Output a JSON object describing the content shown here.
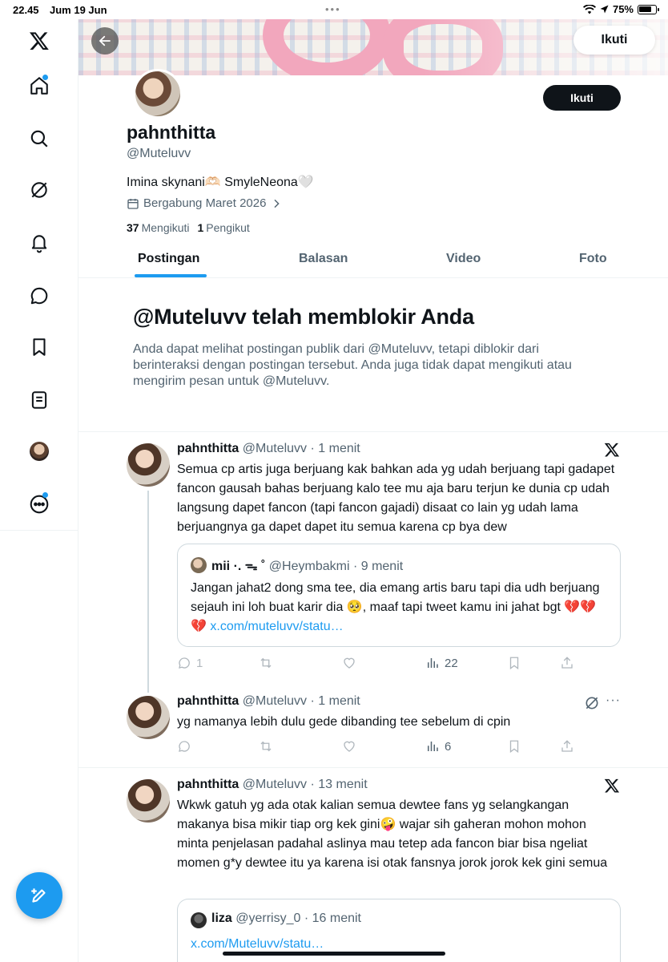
{
  "status_bar": {
    "time": "22.45",
    "date": "Jum 19 Jun",
    "battery": "75%"
  },
  "nav": {
    "items": [
      "x-logo",
      "home",
      "search",
      "grok",
      "notifications",
      "messages",
      "bookmarks",
      "lists",
      "profile",
      "more"
    ]
  },
  "header": {
    "top_follow_label": "Ikuti"
  },
  "profile": {
    "follow_label": "Ikuti",
    "name": "pahnthitta",
    "handle": "@Muteluvv",
    "bio": "Imina skynani🫶🏻 SmyleNeona🤍",
    "joined": "Bergabung Maret 2026",
    "following_count": "37",
    "following_label": "Mengikuti",
    "followers_count": "1",
    "followers_label": "Pengikut"
  },
  "tabs": [
    "Postingan",
    "Balasan",
    "Video",
    "Foto"
  ],
  "blocked": {
    "title": "@Muteluvv telah memblokir Anda",
    "description": "Anda dapat melihat postingan publik dari @Muteluvv, tetapi diblokir dari berinteraksi dengan postingan tersebut. Anda juga tidak dapat mengikuti atau mengirim pesan untuk @Muteluvv."
  },
  "posts": [
    {
      "name": "pahnthitta",
      "meta": "@Muteluvv · 1 menit",
      "text": "Semua cp artis juga berjuang kak bahkan ada yg udah berjuang tapi gadapet fancon gausah bahas berjuang kalo tee mu aja baru terjun ke dunia cp udah langsung dapet fancon (tapi fancon gajadi) disaat co lain yg udah lama berjuangnya ga dapet dapet itu semua karena cp bya dew",
      "quote": {
        "name": "mii ·. ᯓ ˚",
        "meta": "@Heymbakmi · 9 menit",
        "text": "Jangan jahat2 dong sma tee, dia emang artis baru tapi dia udh berjuang sejauh ini loh buat karir dia 🥺, maaf tapi tweet kamu ini jahat bgt 💔💔💔",
        "link": "x.com/muteluvv/statu…"
      },
      "replies": "1",
      "views": "22"
    },
    {
      "name": "pahnthitta",
      "meta": "@Muteluvv · 1 menit",
      "text": "yg namanya lebih dulu gede dibanding tee sebelum di cpin",
      "views": "6"
    },
    {
      "name": "pahnthitta",
      "meta": "@Muteluvv · 13 menit",
      "text": "Wkwk gatuh yg ada otak kalian semua dewtee fans yg selangkangan makanya bisa mikir tiap org kek gini🤪 wajar sih gaheran mohon mohon minta penjelasan padahal aslinya mau tetep ada fancon biar bisa ngeliat momen g*y dewtee itu ya karena isi otak fansnya jorok jorok kek gini semua",
      "quote": {
        "name": "liza",
        "meta": "@yerrisy_0 · 16 menit",
        "link": "x.com/Muteluvv/statu…"
      }
    }
  ],
  "colors": {
    "accent": "#1d9bf0",
    "text": "#0f1419",
    "muted": "#536471",
    "border": "#eff3f4"
  }
}
